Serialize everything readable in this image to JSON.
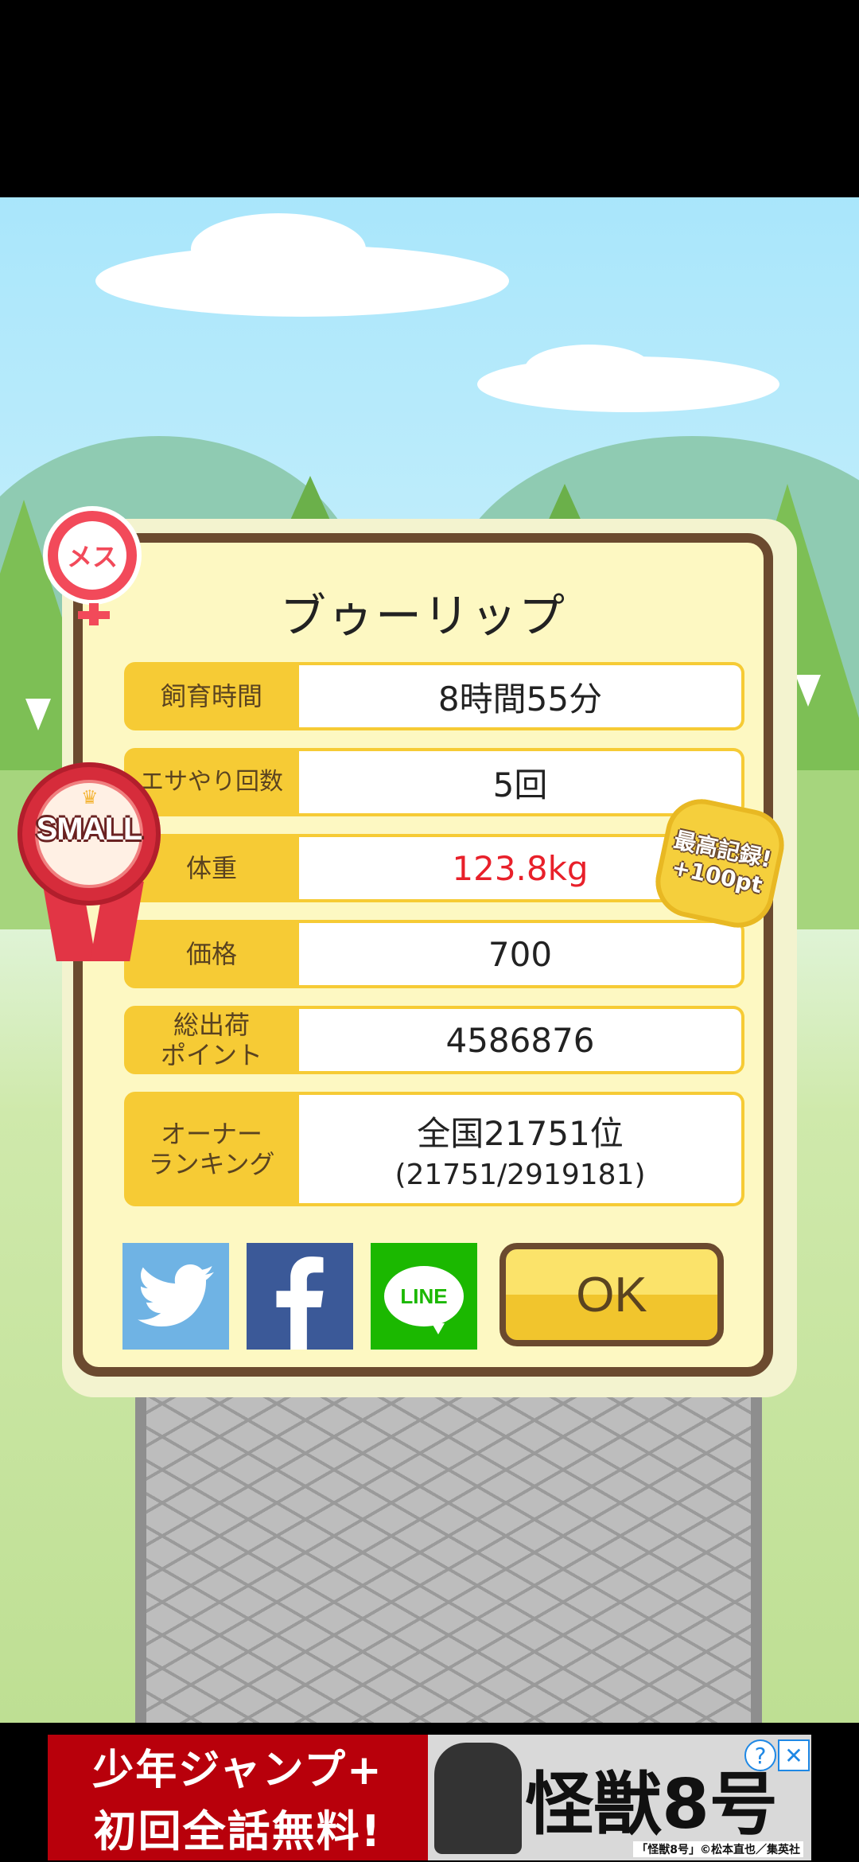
{
  "dialog": {
    "title": "ブゥーリップ",
    "rows": [
      {
        "label": "飼育時間",
        "value": "8時間55分"
      },
      {
        "label": "エサやり回数",
        "value": "5回"
      },
      {
        "label": "体重",
        "value": "123.8kg",
        "highlight": "#e8202a"
      },
      {
        "label": "価格",
        "value": "700"
      },
      {
        "label_line1": "総出荷",
        "label_line2": "ポイント",
        "value": "4586876"
      },
      {
        "label_line1": "オーナー",
        "label_line2": "ランキング",
        "value": "全国21751位",
        "sub_value": "(21751/2919181)"
      }
    ],
    "share": {
      "twitter_icon": "twitter-bird-icon",
      "facebook_icon": "facebook-f-icon",
      "line_label": "LINE"
    },
    "ok_label": "OK"
  },
  "badges": {
    "gender_label": "メス",
    "size_label": "SMALL",
    "record_line1": "最高記録!",
    "record_line2": "+100pt"
  },
  "ad": {
    "left_line1": "少年ジャンプ+",
    "left_line2": "初回全話無料!",
    "right_title": "怪獣8号",
    "credit": "「怪獣8号」©松本直也／集英社",
    "info_icon": "?",
    "close_icon": "✕"
  }
}
